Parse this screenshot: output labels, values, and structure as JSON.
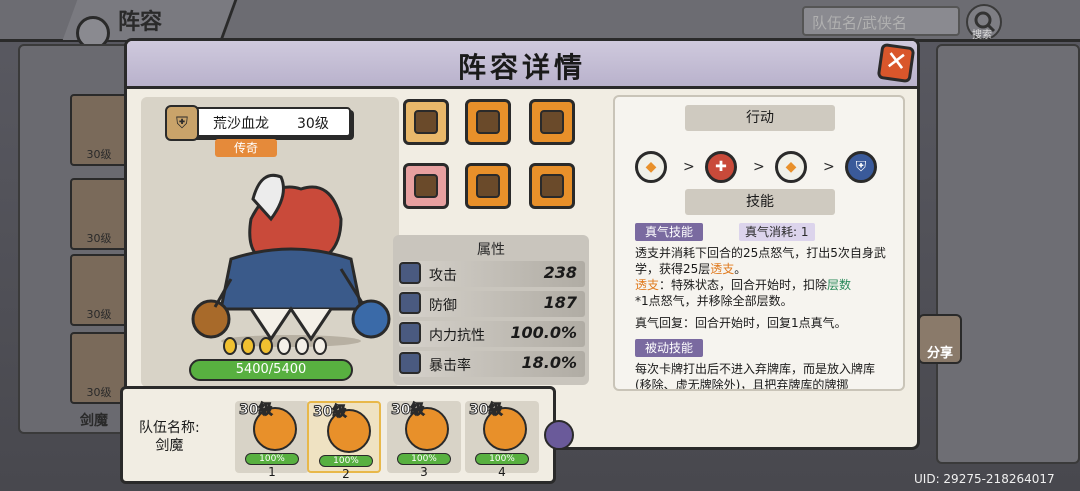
{
  "background": {
    "title": "阵容",
    "search_placeholder": "队伍名/武侠名",
    "search_label": "搜索",
    "sidebar_cards": [
      "30级",
      "30级",
      "30级",
      "30级"
    ],
    "sidebar_team_name": "剑魔",
    "share_label": "分享",
    "uid": "UID: 29275-218264017"
  },
  "modal": {
    "title": "阵容详情",
    "close_icon": "close-x-icon"
  },
  "hero": {
    "name": "荒沙血龙",
    "level": "30级",
    "rarity": "传奇",
    "hp": "5400/5400",
    "hp_fraction": 1.0,
    "orbs_filled": 3,
    "orbs_total": 6
  },
  "equipment": [
    {
      "name": "mace-weapon-icon",
      "style": "sel"
    },
    {
      "name": "hat-icon",
      "style": ""
    },
    {
      "name": "armor-icon",
      "style": ""
    },
    {
      "name": "boots-icon",
      "style": "pink"
    },
    {
      "name": "bracer-icon",
      "style": ""
    },
    {
      "name": "bead-necklace-icon",
      "style": ""
    }
  ],
  "attributes": {
    "title": "属性",
    "rows": [
      {
        "label": "攻击",
        "value": "238",
        "icon": "sword-icon"
      },
      {
        "label": "防御",
        "value": "187",
        "icon": "shield-icon"
      },
      {
        "label": "内力抗性",
        "value": "100.0%",
        "icon": "swirl-icon"
      },
      {
        "label": "暴击率",
        "value": "18.0%",
        "icon": "crit-icon"
      }
    ]
  },
  "actions": {
    "title": "行动",
    "items": [
      "bird-icon",
      "blade-icon",
      "bird-icon",
      "shield-icon"
    ]
  },
  "skills": {
    "title": "技能",
    "zhenqi_tag": "真气技能",
    "zhenqi_cost": "真气消耗: 1",
    "zhenqi_desc": "透支并消耗下回合的25点怒气，打出5次自身武学，获得25层",
    "zhenqi_desc_hl1": "透支",
    "zhenqi_desc_2": "。",
    "zhenqi_desc_term": "透支",
    "zhenqi_desc_3": "：特殊状态，回合开始时，扣除",
    "zhenqi_desc_hl2": "层数",
    "zhenqi_desc_4": "*1点怒气，并移除全部层数。",
    "recover": "真气回复：回合开始时，回复1点真气。",
    "passive_tag": "被动技能",
    "passive_desc": "每次卡牌打出后不进入弃牌库，而是放入牌库(移除、虚无牌除外)，且把弃牌库的牌挪"
  },
  "team": {
    "label": "队伍名称:",
    "name": "剑魔",
    "slots": [
      {
        "level": "30级",
        "pct": "100%",
        "num": "1"
      },
      {
        "level": "30级",
        "pct": "100%",
        "num": "2"
      },
      {
        "level": "30级",
        "pct": "100%",
        "num": "3"
      },
      {
        "level": "30级",
        "pct": "100%",
        "num": "4"
      }
    ]
  }
}
